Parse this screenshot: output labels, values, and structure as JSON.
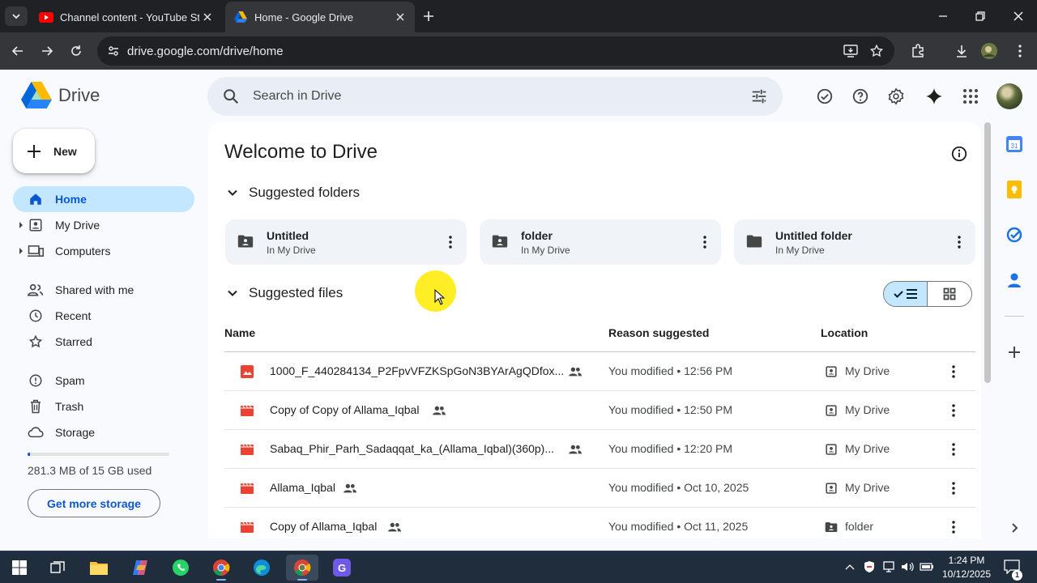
{
  "browser": {
    "tabs": [
      {
        "title": "Channel content - YouTube Stu",
        "active": false
      },
      {
        "title": "Home - Google Drive",
        "active": true
      }
    ],
    "url": "drive.google.com/drive/home"
  },
  "header": {
    "app_name": "Drive",
    "search_placeholder": "Search in Drive"
  },
  "sidebar": {
    "new_label": "New",
    "items": [
      {
        "label": "Home",
        "icon": "home-icon",
        "selected": true
      },
      {
        "label": "My Drive",
        "icon": "my-drive-icon"
      },
      {
        "label": "Computers",
        "icon": "computers-icon"
      },
      {
        "label": "Shared with me",
        "icon": "shared-icon"
      },
      {
        "label": "Recent",
        "icon": "clock-icon"
      },
      {
        "label": "Starred",
        "icon": "star-icon"
      },
      {
        "label": "Spam",
        "icon": "spam-icon"
      },
      {
        "label": "Trash",
        "icon": "trash-icon"
      },
      {
        "label": "Storage",
        "icon": "cloud-icon"
      }
    ],
    "storage_used_fraction": 0.019,
    "storage_used_text": "281.3 MB of 15 GB used",
    "get_more_label": "Get more storage"
  },
  "main": {
    "welcome": "Welcome to Drive",
    "suggested_folders_title": "Suggested folders",
    "folders": [
      {
        "name": "Untitled",
        "location": "In My Drive",
        "icon": "shared-folder-icon"
      },
      {
        "name": "folder",
        "location": "In My Drive",
        "icon": "shared-folder-icon"
      },
      {
        "name": "Untitled folder",
        "location": "In My Drive",
        "icon": "folder-icon"
      }
    ],
    "suggested_files_title": "Suggested files",
    "columns": {
      "name": "Name",
      "reason": "Reason suggested",
      "location": "Location"
    },
    "files": [
      {
        "name": "1000_F_440284134_P2FpvVFZKSpGoN3BYArAgQDfox...",
        "type": "image",
        "reason": "You modified • 12:56 PM",
        "location": "My Drive"
      },
      {
        "name": "Copy of Copy of Allama_Iqbal",
        "type": "video",
        "reason": "You modified • 12:50 PM",
        "location": "My Drive"
      },
      {
        "name": "Sabaq_Phir_Parh_Sadaqqat_ka_(Allama_Iqbal)(360p)...",
        "type": "video",
        "reason": "You modified • 12:20 PM",
        "location": "My Drive"
      },
      {
        "name": "Allama_Iqbal",
        "type": "video",
        "reason": "You modified • Oct 10, 2025",
        "location": "My Drive"
      },
      {
        "name": "Copy of Allama_Iqbal",
        "type": "video",
        "reason": "You modified • Oct 11, 2025",
        "location": "folder"
      }
    ]
  },
  "taskbar": {
    "time": "1:24 PM",
    "date": "10/12/2025",
    "notification_count": "1"
  },
  "colors": {
    "accent": "#0b57d0",
    "selected_bg": "#c2e7ff",
    "video_red": "#ea4335"
  }
}
